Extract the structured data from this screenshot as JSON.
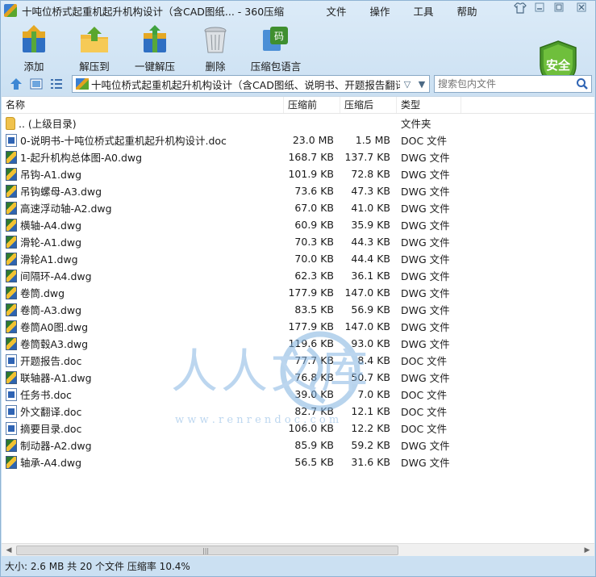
{
  "window": {
    "title": "十吨位桥式起重机起升机构设计（含CAD图纸... - 360压缩",
    "controls": [
      "shirt-icon",
      "minimize-icon",
      "restore-icon",
      "close-icon"
    ]
  },
  "menu": {
    "items": [
      "文件",
      "操作",
      "工具",
      "帮助"
    ]
  },
  "toolbar": {
    "buttons": [
      {
        "label": "添加",
        "icon": "add-archive-icon"
      },
      {
        "label": "解压到",
        "icon": "extract-to-icon"
      },
      {
        "label": "一键解压",
        "icon": "one-click-extract-icon"
      },
      {
        "label": "删除",
        "icon": "trash-icon"
      },
      {
        "label": "压缩包语言",
        "icon": "archive-language-icon"
      }
    ],
    "security_badge": "安全"
  },
  "addressbar": {
    "path": "十吨位桥式起重机起升机构设计（含CAD图纸、说明书、开题报告翻译...",
    "search_placeholder": "搜索包内文件"
  },
  "columns": {
    "name": "名称",
    "compressed": "压缩前",
    "original": "压缩后",
    "type": "类型"
  },
  "files": [
    {
      "name": ".. (上级目录)",
      "before": "",
      "after": "",
      "type": "文件夹",
      "kind": "folder"
    },
    {
      "name": "0-说明书-十吨位桥式起重机起升机构设计.doc",
      "before": "23.0 MB",
      "after": "1.5 MB",
      "type": "DOC 文件",
      "kind": "doc"
    },
    {
      "name": "1-起升机构总体图-A0.dwg",
      "before": "168.7 KB",
      "after": "137.7 KB",
      "type": "DWG 文件",
      "kind": "dwg"
    },
    {
      "name": "吊钩-A1.dwg",
      "before": "101.9 KB",
      "after": "72.8 KB",
      "type": "DWG 文件",
      "kind": "dwg"
    },
    {
      "name": "吊钩螺母-A3.dwg",
      "before": "73.6 KB",
      "after": "47.3 KB",
      "type": "DWG 文件",
      "kind": "dwg"
    },
    {
      "name": "高速浮动轴-A2.dwg",
      "before": "67.0 KB",
      "after": "41.0 KB",
      "type": "DWG 文件",
      "kind": "dwg"
    },
    {
      "name": "横轴-A4.dwg",
      "before": "60.9 KB",
      "after": "35.9 KB",
      "type": "DWG 文件",
      "kind": "dwg"
    },
    {
      "name": "滑轮-A1.dwg",
      "before": "70.3 KB",
      "after": "44.3 KB",
      "type": "DWG 文件",
      "kind": "dwg"
    },
    {
      "name": "滑轮A1.dwg",
      "before": "70.0 KB",
      "after": "44.4 KB",
      "type": "DWG 文件",
      "kind": "dwg"
    },
    {
      "name": "间隔环-A4.dwg",
      "before": "62.3 KB",
      "after": "36.1 KB",
      "type": "DWG 文件",
      "kind": "dwg"
    },
    {
      "name": "卷筒.dwg",
      "before": "177.9 KB",
      "after": "147.0 KB",
      "type": "DWG 文件",
      "kind": "dwg"
    },
    {
      "name": "卷筒-A3.dwg",
      "before": "83.5 KB",
      "after": "56.9 KB",
      "type": "DWG 文件",
      "kind": "dwg"
    },
    {
      "name": "卷筒A0图.dwg",
      "before": "177.9 KB",
      "after": "147.0 KB",
      "type": "DWG 文件",
      "kind": "dwg"
    },
    {
      "name": "卷筒毂A3.dwg",
      "before": "119.6 KB",
      "after": "93.0 KB",
      "type": "DWG 文件",
      "kind": "dwg"
    },
    {
      "name": "开题报告.doc",
      "before": "77.7 KB",
      "after": "8.4 KB",
      "type": "DOC 文件",
      "kind": "doc"
    },
    {
      "name": "联轴器-A1.dwg",
      "before": "76.8 KB",
      "after": "50.7 KB",
      "type": "DWG 文件",
      "kind": "dwg"
    },
    {
      "name": "任务书.doc",
      "before": "39.0 KB",
      "after": "7.0 KB",
      "type": "DOC 文件",
      "kind": "doc"
    },
    {
      "name": "外文翻译.doc",
      "before": "82.7 KB",
      "after": "12.1 KB",
      "type": "DOC 文件",
      "kind": "doc"
    },
    {
      "name": "摘要目录.doc",
      "before": "106.0 KB",
      "after": "12.2 KB",
      "type": "DOC 文件",
      "kind": "doc"
    },
    {
      "name": "制动器-A2.dwg",
      "before": "85.9 KB",
      "after": "59.2 KB",
      "type": "DWG 文件",
      "kind": "dwg"
    },
    {
      "name": "轴承-A4.dwg",
      "before": "56.5 KB",
      "after": "31.6 KB",
      "type": "DWG 文件",
      "kind": "dwg"
    }
  ],
  "watermark": {
    "text": "人人文库",
    "url": "w w w . r e n r e n d o c . c o m"
  },
  "status": {
    "text": "大小: 2.6 MB 共 20 个文件 压缩率 10.4%"
  },
  "colors": {
    "accent": "#2f64b4",
    "badge_green": "#4c9a2a",
    "window_bg": "#cfe3f3"
  }
}
